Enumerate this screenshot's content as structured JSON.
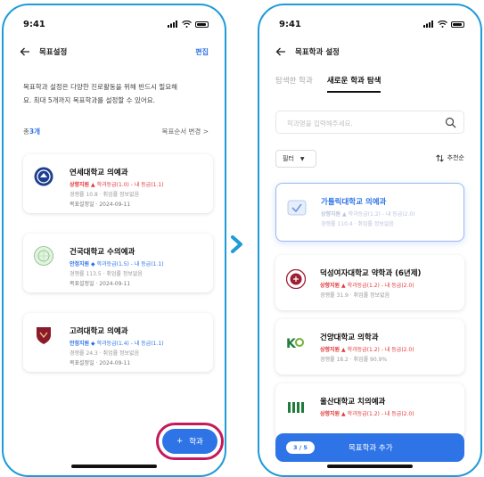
{
  "colors": {
    "accent": "#2f74e6",
    "frame": "#1e9bd9",
    "highlight_ring": "#c51b5a",
    "risk_up": "#e3383b"
  },
  "left_screen": {
    "status_time": "9:41",
    "nav": {
      "back_icon": "arrow-left-icon",
      "title": "목표설정",
      "edit": "편집"
    },
    "description": [
      "목표학과 설정은 다양한 진로활동을 위해 반드시 필요해",
      "요. 최대 5개까지 목표학과를 설정할 수 있어요."
    ],
    "count_prefix": "총 ",
    "count_value": "3개",
    "order_change": "목표순서 변경 >",
    "cards": [
      {
        "name": "연세대학교 의예과",
        "risk": "상향지원",
        "risk_type": "up",
        "marker": "▲",
        "grade": "학과등급(1.0) - 내 등급(1.1)",
        "stats": "경쟁률 10.8 · 취업률 정보없음",
        "date": "목표설정일 · 2024-09-11"
      },
      {
        "name": "건국대학교 수의예과",
        "risk": "안정지원",
        "risk_type": "safe",
        "marker": "◆",
        "grade": "학과등급(1.5) - 내 등급(1.1)",
        "stats": "경쟁률 113.5 · 취업률 정보없음",
        "date": "목표설정일 · 2024-09-11"
      },
      {
        "name": "고려대학교 의예과",
        "risk": "안정지원",
        "risk_type": "safe",
        "marker": "◆",
        "grade": "학과등급(1.4) - 내 등급(1.1)",
        "stats": "경쟁률 24.3 · 취업률 정보없음",
        "date": "목표설정일 · 2024-09-11"
      }
    ],
    "fab": {
      "plus": "+",
      "label": "학과"
    }
  },
  "right_screen": {
    "status_time": "9:41",
    "nav": {
      "back_icon": "arrow-left-icon",
      "title": "목표학과 설정"
    },
    "tabs": [
      "탐색한 학과",
      "새로운 학과 탐색"
    ],
    "search_placeholder": "학과명을 입력해주세요.",
    "filter_label": "필터",
    "sort_label": "추천순",
    "cards": [
      {
        "name": "가톨릭대학교 의예과",
        "risk": "상향지원",
        "marker": "▲",
        "grade": "학과등급(1.2) - 내 등급(2.0)",
        "stats": "경쟁률 110.4 · 취업률 정보없음"
      },
      {
        "name": "덕성여자대학교 약학과 (6년제)",
        "risk": "상향지원",
        "marker": "▲",
        "grade": "학과등급(1.2) - 내 등급(2.0)",
        "stats": "경쟁률 31.9 · 취업률 정보없음"
      },
      {
        "name": "건양대학교 의학과",
        "risk": "상향지원",
        "marker": "▲",
        "grade": "학과등급(1.2) - 내 등급(2.0)",
        "stats": "경쟁률 18.2 · 취업률 90.9%"
      },
      {
        "name": "울산대학교 치의예과",
        "risk": "상향지원",
        "marker": "▲",
        "grade": "학과등급(1.2) - 내 등급(2.0)",
        "stats": ""
      }
    ],
    "bottom_button": {
      "progress": "3 / 5",
      "label": "목표학과 추가"
    }
  }
}
